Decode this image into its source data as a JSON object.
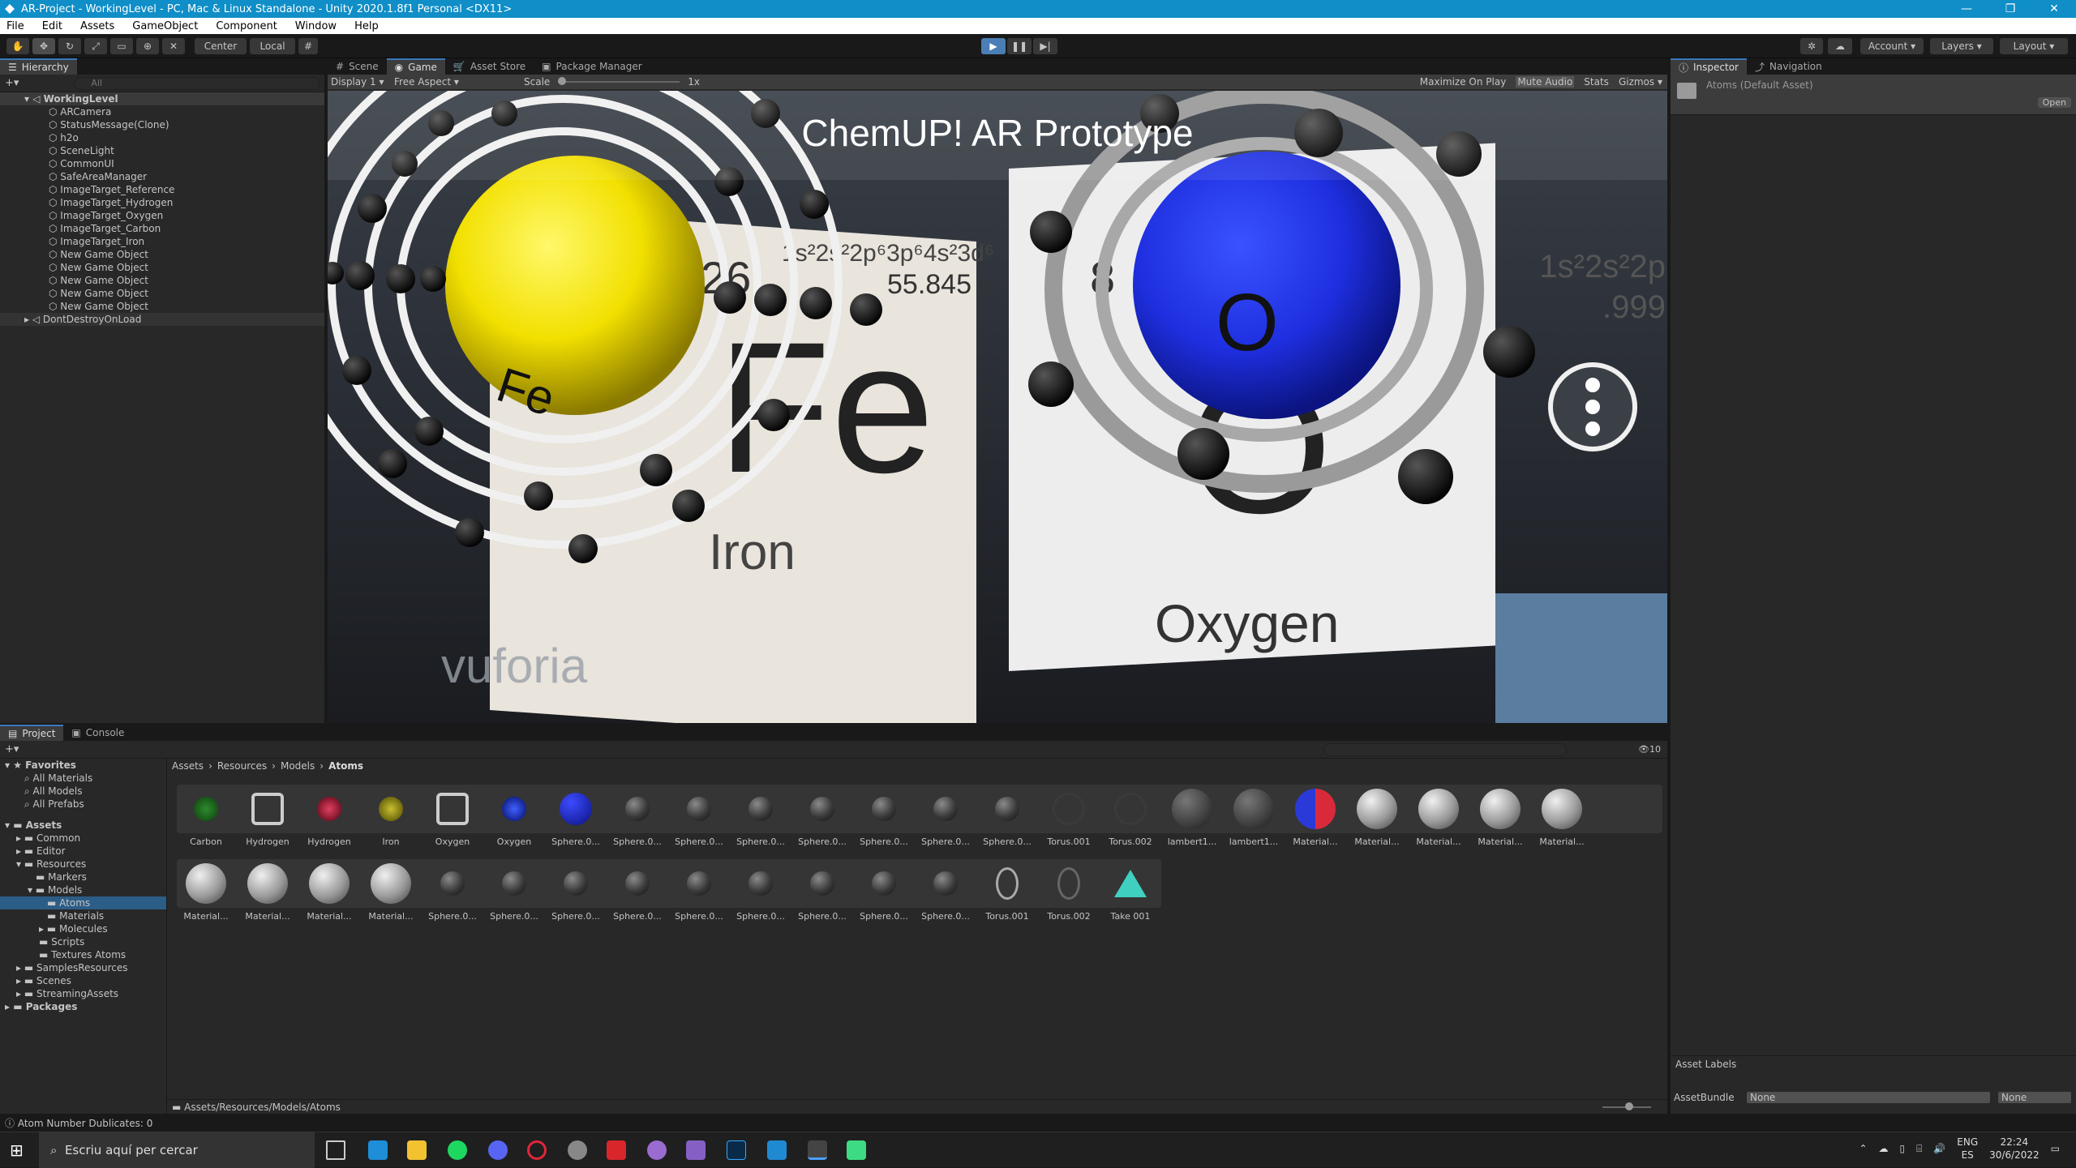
{
  "window": {
    "title": "AR-Project - WorkingLevel - PC, Mac & Linux Standalone - Unity 2020.1.8f1 Personal <DX11>"
  },
  "menu": [
    "File",
    "Edit",
    "Assets",
    "GameObject",
    "Component",
    "Window",
    "Help"
  ],
  "toolbar": {
    "center": "Center",
    "local": "Local",
    "account": "Account",
    "layers": "Layers",
    "layout": "Layout"
  },
  "hierarchy": {
    "tab": "Hierarchy",
    "search_placeholder": "All",
    "scene": "WorkingLevel",
    "items": [
      "ARCamera",
      "StatusMessage(Clone)",
      "h2o",
      "SceneLight",
      "CommonUI",
      "SafeAreaManager",
      "ImageTarget_Reference",
      "ImageTarget_Hydrogen",
      "ImageTarget_Oxygen",
      "ImageTarget_Carbon",
      "ImageTarget_Iron",
      "New Game Object",
      "New Game Object",
      "New Game Object",
      "New Game Object",
      "New Game Object"
    ],
    "dont_destroy": "DontDestroyOnLoad"
  },
  "game_tabs": [
    "Scene",
    "Game",
    "Asset Store",
    "Package Manager"
  ],
  "game_bar": {
    "display": "Display 1",
    "aspect": "Free Aspect",
    "scale": "Scale",
    "scale_value": "1x",
    "maximize": "Maximize On Play",
    "mute": "Mute Audio",
    "stats": "Stats",
    "gizmos": "Gizmos"
  },
  "game_view": {
    "title": "ChemUP! AR Prototype",
    "card_left": {
      "config": "1s²2s²2p⁶3p⁶4s²3d⁶",
      "mass": "55.845 u",
      "symbol": "Fe",
      "name": "Iron",
      "number": "26"
    },
    "card_right": {
      "config": "1s²2s²2p",
      "mass": ".999",
      "symbol": "O",
      "name": "Oxygen",
      "number": "8"
    },
    "sphere_left_label": "Fe",
    "sphere_right_label": "O",
    "watermark": "vuforia"
  },
  "inspector": {
    "tabs": [
      "Inspector",
      "Navigation"
    ],
    "asset": "Atoms (Default Asset)",
    "open": "Open",
    "labels": "Asset Labels",
    "bundle_label": "AssetBundle",
    "bundle_value": "None",
    "bundle_variant": "None"
  },
  "project": {
    "tabs": [
      "Project",
      "Console"
    ],
    "favorites": "Favorites",
    "fav_items": [
      "All Materials",
      "All Models",
      "All Prefabs"
    ],
    "assets": "Assets",
    "asset_tree": [
      "Common",
      "Editor",
      "Resources",
      "Markers",
      "Models",
      "Atoms",
      "Materials",
      "Molecules",
      "Scripts",
      "Textures Atoms",
      "SamplesResources",
      "Scenes",
      "StreamingAssets"
    ],
    "packages": "Packages",
    "breadcrumb": [
      "Assets",
      "Resources",
      "Models",
      "Atoms"
    ],
    "path": "Assets/Resources/Models/Atoms",
    "count": "10",
    "row1": [
      "Carbon",
      "Hydrogen",
      "Hydrogen",
      "Iron",
      "Oxygen",
      "Oxygen",
      "Sphere.0...",
      "Sphere.0...",
      "Sphere.0...",
      "Sphere.0...",
      "Sphere.0...",
      "Sphere.0...",
      "Sphere.0...",
      "Sphere.0...",
      "Torus.001",
      "Torus.002",
      "lambert1...",
      "lambert1...",
      "Material...",
      "Material...",
      "Material...",
      "Material...",
      "Material..."
    ],
    "row2": [
      "Material...",
      "Material...",
      "Material...",
      "Material...",
      "Sphere.0...",
      "Sphere.0...",
      "Sphere.0...",
      "Sphere.0...",
      "Sphere.0...",
      "Sphere.0...",
      "Sphere.0...",
      "Sphere.0...",
      "Sphere.0...",
      "Torus.001",
      "Torus.002",
      "Take 001"
    ]
  },
  "status": {
    "message": "Atom Number Dublicates: 0"
  },
  "taskbar": {
    "search": "Escriu aquí per cercar",
    "lang1": "ENG",
    "lang2": "ES",
    "time": "22:24",
    "date": "30/6/2022"
  },
  "colors": {
    "accent": "#3a79bb",
    "titlebar": "#0f8ec7",
    "iron": "#f2e000",
    "oxygen": "#1e2fe0"
  }
}
